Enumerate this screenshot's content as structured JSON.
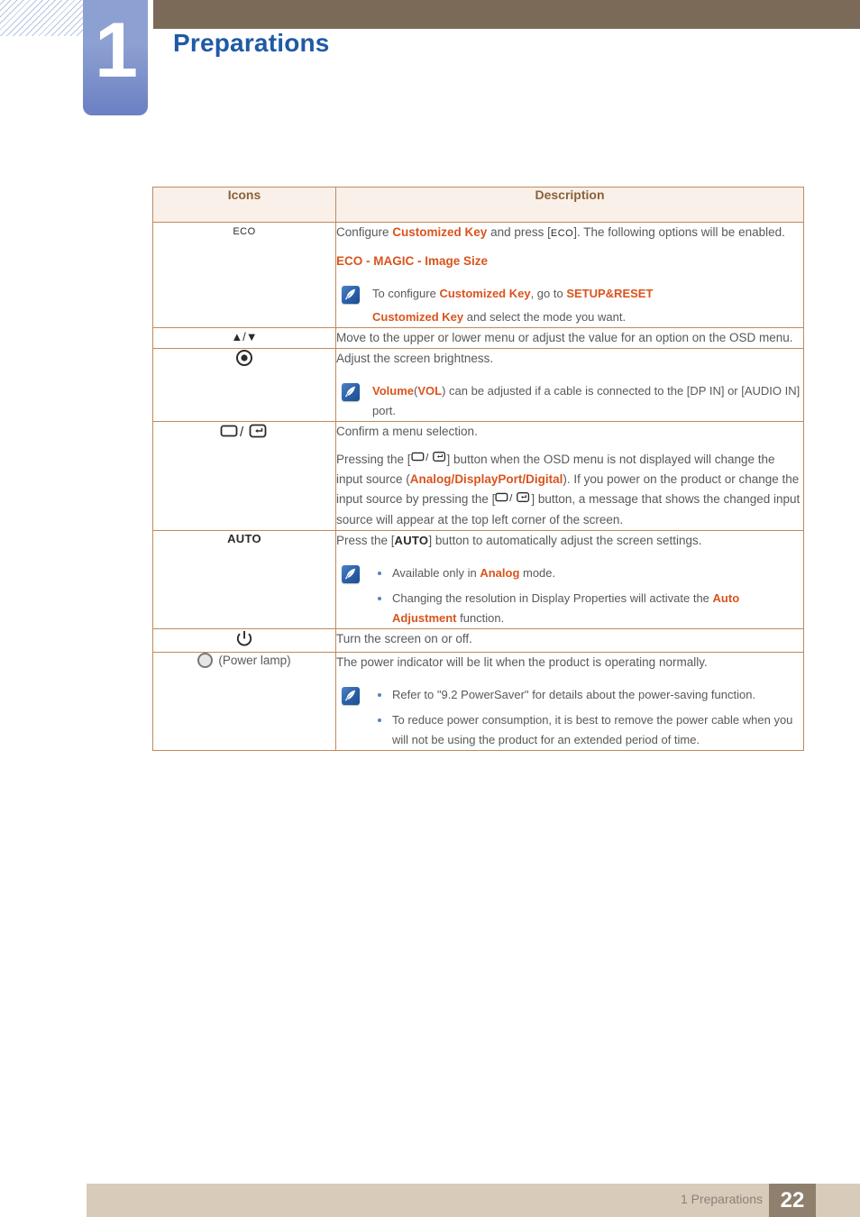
{
  "header": {
    "chapter_number": "1",
    "chapter_title": "Preparations"
  },
  "table": {
    "columns": [
      "Icons",
      "Description"
    ],
    "rows": [
      {
        "icon_label": "ECO",
        "icon_type": "text",
        "paragraphs": [
          "Configure Customized Key and press [ECO]. The following options will be enabled.",
          "ECO - MAGIC - Image Size"
        ],
        "note": "To configure Customized Key, go to SETUP&RESET Customized Key and select the mode you want."
      },
      {
        "icon_label": "▲/▼",
        "icon_type": "arrows",
        "paragraphs": [
          "Move to the upper or lower menu or adjust the value for an option on the OSD menu."
        ]
      },
      {
        "icon_label": "brightness-dot",
        "icon_type": "brightness",
        "paragraphs": [
          "Adjust the screen brightness."
        ],
        "note": "Volume(VOL) can be adjusted if a cable is connected to the [DP IN] or [AUDIO IN] port."
      },
      {
        "icon_label": "menu-enter",
        "icon_type": "menu-enter",
        "paragraphs": [
          "Confirm a menu selection.",
          "Pressing the [▭/↵] button when the OSD menu is not displayed will change the input source (Analog/DisplayPort/Digital). If you power on the product or change the input source by pressing the [▭/↵] button, a message that shows the changed input source will appear at the top left corner of the screen."
        ]
      },
      {
        "icon_label": "AUTO",
        "icon_type": "text",
        "paragraphs": [
          "Press the [AUTO] button to automatically adjust the screen settings."
        ],
        "bullets": [
          "Available only in Analog mode.",
          "Changing the resolution in Display Properties will activate the Auto Adjustment function."
        ]
      },
      {
        "icon_label": "power-symbol",
        "icon_type": "power",
        "paragraphs": [
          "Turn the screen on or off."
        ]
      },
      {
        "icon_label": "(Power lamp)",
        "icon_type": "power-lamp",
        "paragraphs": [
          "The power indicator will be lit when the product is operating normally."
        ],
        "bullets": [
          "Refer to \"9.2 PowerSaver\" for details about the power-saving function.",
          "To reduce power consumption, it is best to remove the power cable when you will not be using the product for an extended period of time."
        ]
      }
    ],
    "text_fragments": {
      "r1_p1_a": "Configure ",
      "r1_p1_key": "Customized Key",
      "r1_p1_b": " and press [",
      "r1_p1_kbd": "ECO",
      "r1_p1_c": "]. The following options will be enabled.",
      "r1_p2_eco": "ECO",
      "r1_p2_dash1": " - ",
      "r1_p2_magic": "MAGIC",
      "r1_p2_dash2": " - ",
      "r1_p2_size": "Image Size",
      "r1_note_a": "To configure ",
      "r1_note_key1": "Customized Key",
      "r1_note_b": ", go to ",
      "r1_note_setup": "SETUP&RESET",
      "r1_note_key2": "Customized Key",
      "r1_note_c": " and select the mode you want.",
      "r2_p1": "Move to the upper or lower menu or adjust the value for an option on the OSD menu.",
      "r3_p1": "Adjust the screen brightness.",
      "r3_note_vol": "Volume",
      "r3_note_paren_open": "(",
      "r3_note_vol2": "VOL",
      "r3_note_rest": ") can be adjusted if a cable is connected to the [DP IN] or [AUDIO IN] port.",
      "r4_p1": "Confirm a menu selection.",
      "r4_p2_a": "Pressing the [",
      "r4_p2_b": "] button when the OSD menu is not displayed will change the input source (",
      "r4_p2_analog": "Analog",
      "r4_p2_slash1": "/",
      "r4_p2_dp": "DisplayPort",
      "r4_p2_slash2": "/",
      "r4_p2_digital": "Digital",
      "r4_p2_c": "). If you power on the product or change the input source by pressing the [",
      "r4_p2_d": "] button, a message that shows the changed input source will appear at the top left corner of the screen.",
      "r5_p1_a": "Press the [",
      "r5_p1_kbd": "AUTO",
      "r5_p1_b": "] button to automatically adjust the screen settings.",
      "r5_b1_a": "Available only in ",
      "r5_b1_analog": "Analog",
      "r5_b1_b": " mode.",
      "r5_b2_a": "Changing the resolution in Display Properties will activate the ",
      "r5_b2_auto": "Auto Adjustment",
      "r5_b2_b": " function.",
      "r6_p1": "Turn the screen on or off.",
      "r7_lamp_label": "(Power lamp)",
      "r7_p1": "The power indicator will be lit when the product is operating normally.",
      "r7_b1": "Refer to \"9.2 PowerSaver\" for details about the power-saving function.",
      "r7_b2": "To reduce power consumption, it is best to remove the power cable when you will not be using the product for an extended period of time."
    }
  },
  "footer": {
    "section_label": "1 Preparations",
    "page_number": "22"
  },
  "colors": {
    "banner_brown": "#7a6a57",
    "badge_blue": "#8da0d2",
    "title_blue": "#1f5aa6",
    "accent_orange": "#d9541e",
    "table_border": "#c08a5a",
    "table_header_bg": "#faf0ea",
    "table_header_text": "#8a6239",
    "footer_bar": "#d8cbba",
    "footer_page_box": "#8f7f6d"
  }
}
